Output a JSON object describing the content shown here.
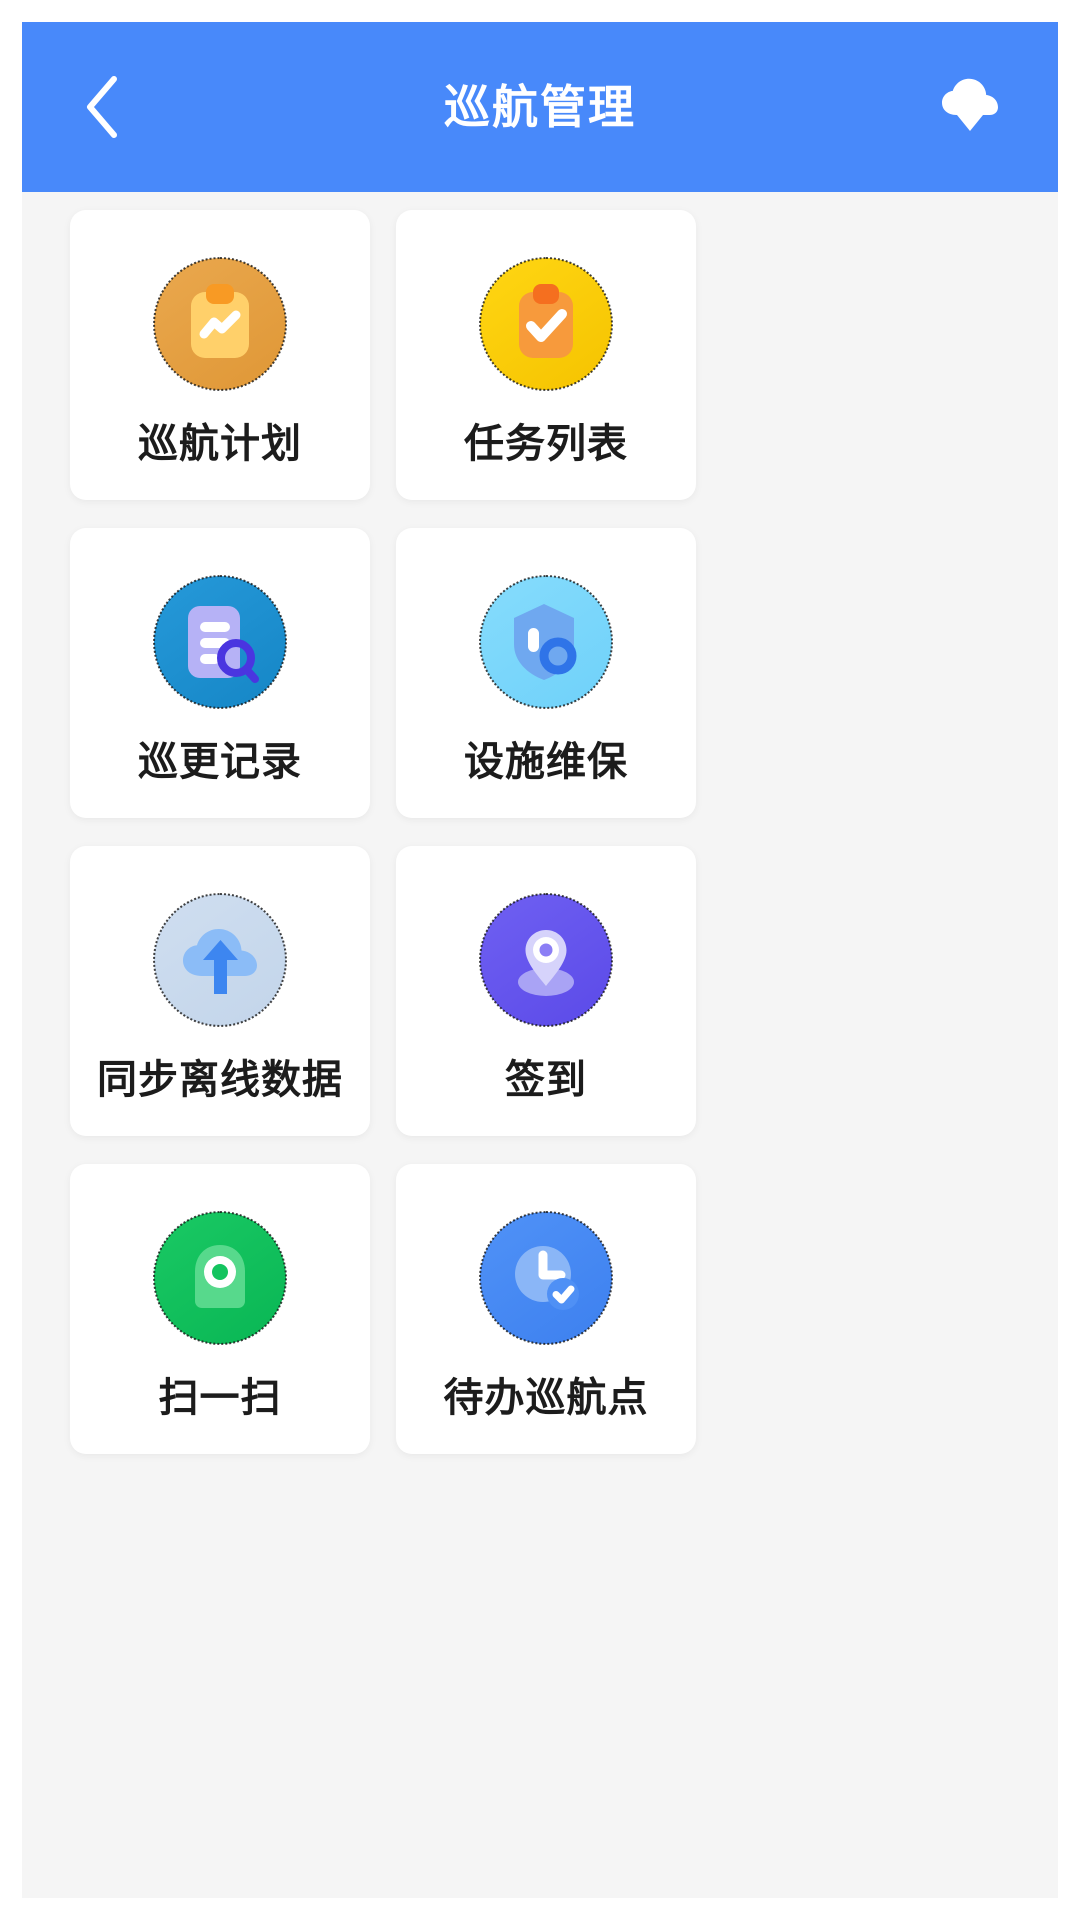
{
  "app": {
    "background": "#f5f5f5",
    "accent": "#4889fa"
  },
  "header": {
    "title": "巡航管理",
    "background": "#4889fa",
    "title_color": "#ffffff",
    "back_icon": "chevron-left-icon",
    "action_icon": "cloud-download-icon"
  },
  "grid": {
    "columns": 3,
    "items": [
      {
        "id": "patrol-plan",
        "label": "巡航计划",
        "icon": "clipboard-chart-icon",
        "circle_color": "#e8a council",
        "circle_from": "#eaa84e",
        "circle_to": "#e09a3c",
        "fg_color": "#ffd064",
        "accent_color": "#f79a24"
      },
      {
        "id": "task-list",
        "label": "任务列表",
        "icon": "clipboard-check-icon",
        "circle_from": "#ffd413",
        "circle_to": "#f7c500",
        "fg_color": "#f79a3c",
        "accent_color": "#f56f1f"
      },
      {
        "id": "patrol-record",
        "label": "巡更记录",
        "icon": "document-search-icon",
        "circle_from": "#2196d6",
        "circle_to": "#1789c9",
        "fg_color": "#b4b0f5",
        "accent_color": "#4a35e0"
      },
      {
        "id": "facility-maintenance",
        "label": "设施维保",
        "icon": "shield-check-icon",
        "circle_from": "#7ed8fb",
        "circle_to": "#72d3fa",
        "fg_color": "#6fa8f0",
        "accent_color": "#2f74e8"
      },
      {
        "id": "sync-offline-data",
        "label": "同步离线数据",
        "icon": "cloud-upload-icon",
        "circle_from": "#ccdcef",
        "circle_to": "#c6d7ec",
        "fg_color": "#8bbcf7",
        "accent_color": "#3d86f0"
      },
      {
        "id": "check-in",
        "label": "签到",
        "icon": "location-person-icon",
        "circle_from": "#6b5cf0",
        "circle_to": "#5d4dea",
        "fg_color": "#a9a3f5",
        "accent_color": "#ffffff"
      },
      {
        "id": "scan",
        "label": "扫一扫",
        "icon": "scan-camera-icon",
        "circle_from": "#15c55f",
        "circle_to": "#0cb957",
        "fg_color": "#57d98c",
        "accent_color": "#ffffff"
      },
      {
        "id": "pending-patrol-point",
        "label": "待办巡航点",
        "icon": "clock-check-icon",
        "circle_from": "#4c8ef5",
        "circle_to": "#3f82f0",
        "fg_color": "#8ab6f7",
        "accent_color": "#ffffff"
      }
    ]
  }
}
